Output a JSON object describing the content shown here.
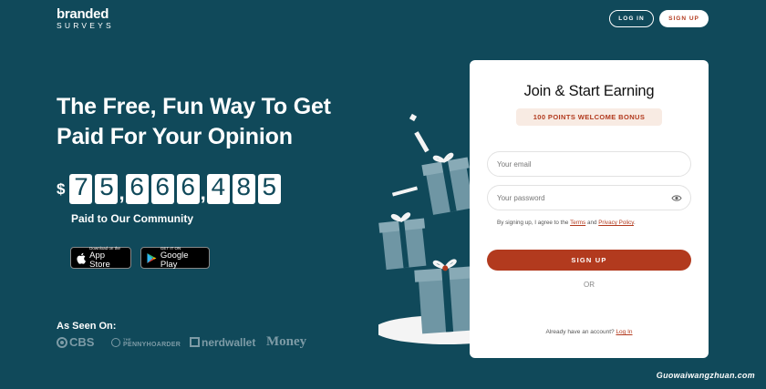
{
  "logo": {
    "line1": "branded",
    "line2": "SURVEYS"
  },
  "nav": {
    "login": "LOG IN",
    "signup": "SIGN UP"
  },
  "hero": {
    "title": "The Free, Fun Way To Get Paid For Your Opinion",
    "currency": "$",
    "digits": [
      "7",
      "5",
      ",",
      "6",
      "6",
      "6",
      ",",
      "4",
      "8",
      "5"
    ],
    "paid_label": "Paid to Our Community"
  },
  "stores": {
    "app_store": {
      "small": "Download on the",
      "big": "App Store",
      "icon": "apple-icon"
    },
    "google_play": {
      "small": "GET IT ON",
      "big": "Google Play",
      "icon": "google-play-icon"
    }
  },
  "seen_on": {
    "label": "As Seen On:",
    "brands": [
      "CBS",
      "PENNYHOARDER",
      "nerdwallet",
      "Money"
    ],
    "penny_prefix": "THE"
  },
  "form": {
    "title": "Join & Start Earning",
    "bonus": "100 POINTS WELCOME BONUS",
    "email_placeholder": "Your email",
    "password_placeholder": "Your password",
    "terms_prefix": "By signing up, I agree to the ",
    "terms_link": "Terms",
    "terms_and": " and ",
    "privacy_link": "Privacy Policy",
    "terms_suffix": ".",
    "submit": "SIGN UP",
    "or": "OR",
    "already": "Already have an account? ",
    "login_link": "Log In"
  },
  "watermark": "Guowaiwangzhuan.com",
  "colors": {
    "background": "#10495a",
    "accent": "#b23a1e",
    "gift_blue": "#6f96a4",
    "bonus_bg": "#f8ebe3"
  }
}
